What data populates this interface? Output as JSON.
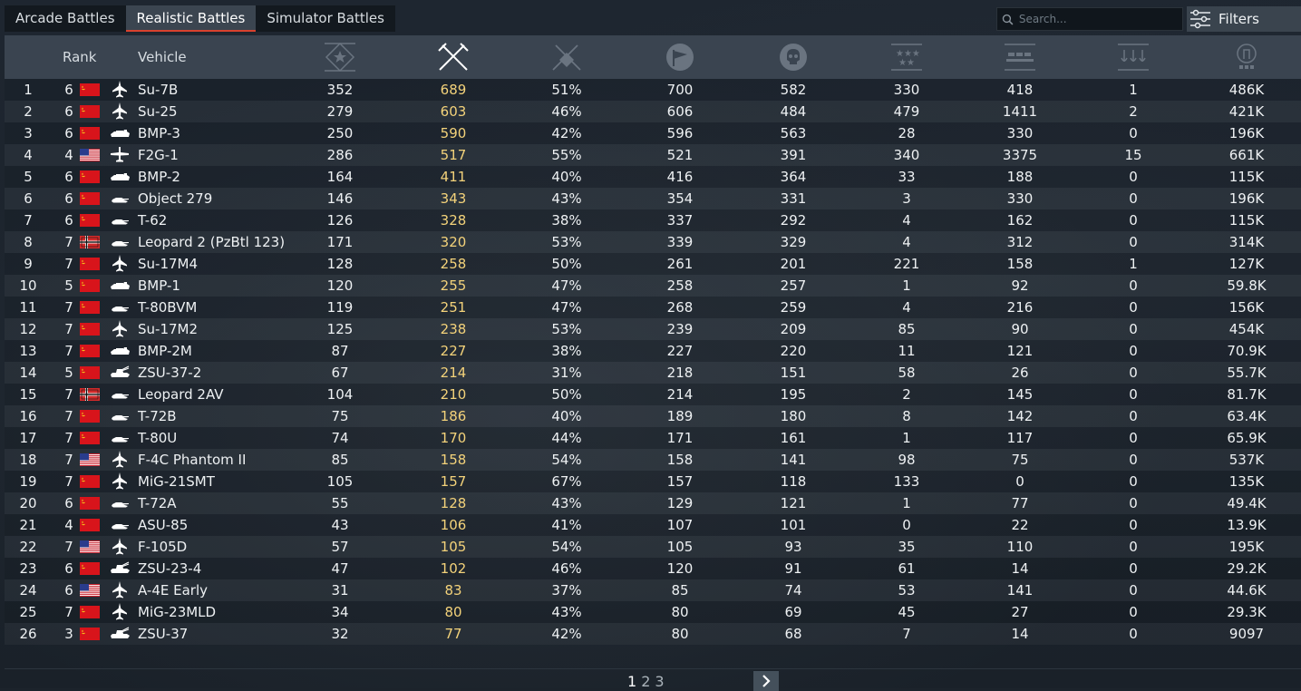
{
  "tabs": [
    {
      "label": "Arcade Battles",
      "active": false
    },
    {
      "label": "Realistic Battles",
      "active": true
    },
    {
      "label": "Simulator Battles",
      "active": false
    }
  ],
  "search": {
    "placeholder": "Search..."
  },
  "filters": {
    "label": "Filters"
  },
  "columns": {
    "rank": "Rank",
    "vehicle": "Vehicle",
    "icons": [
      "rating-icon",
      "battles-icon",
      "win-rate-icon",
      "victories-icon",
      "deaths-icon",
      "air-kills-icon",
      "ground-kills-icon",
      "naval-kills-icon",
      "rewards-icon"
    ]
  },
  "colors": {
    "accent": "#d9412e",
    "highlight": "#f3d27a",
    "header_bg": "#3a4450"
  },
  "rows": [
    {
      "pos": "1",
      "rank": "6",
      "nation": "ussr",
      "type": "jet",
      "vehicle": "Su-7B",
      "v1": "352",
      "battles": "689",
      "winrate": "51%",
      "v2": "700",
      "v3": "582",
      "v4": "330",
      "v5": "418",
      "v6": "1",
      "v7": "486K"
    },
    {
      "pos": "2",
      "rank": "6",
      "nation": "ussr",
      "type": "jet",
      "vehicle": "Su-25",
      "v1": "279",
      "battles": "603",
      "winrate": "46%",
      "v2": "606",
      "v3": "484",
      "v4": "479",
      "v5": "1411",
      "v6": "2",
      "v7": "421K"
    },
    {
      "pos": "3",
      "rank": "6",
      "nation": "ussr",
      "type": "ifv",
      "vehicle": "BMP-3",
      "v1": "250",
      "battles": "590",
      "winrate": "42%",
      "v2": "596",
      "v3": "563",
      "v4": "28",
      "v5": "330",
      "v6": "0",
      "v7": "196K"
    },
    {
      "pos": "4",
      "rank": "4",
      "nation": "usa",
      "type": "prop",
      "vehicle": "F2G-1",
      "v1": "286",
      "battles": "517",
      "winrate": "55%",
      "v2": "521",
      "v3": "391",
      "v4": "340",
      "v5": "3375",
      "v6": "15",
      "v7": "661K"
    },
    {
      "pos": "5",
      "rank": "6",
      "nation": "ussr",
      "type": "ifv",
      "vehicle": "BMP-2",
      "v1": "164",
      "battles": "411",
      "winrate": "40%",
      "v2": "416",
      "v3": "364",
      "v4": "33",
      "v5": "188",
      "v6": "0",
      "v7": "115K"
    },
    {
      "pos": "6",
      "rank": "6",
      "nation": "ussr",
      "type": "tank",
      "vehicle": "Object 279",
      "v1": "146",
      "battles": "343",
      "winrate": "43%",
      "v2": "354",
      "v3": "331",
      "v4": "3",
      "v5": "330",
      "v6": "0",
      "v7": "196K"
    },
    {
      "pos": "7",
      "rank": "6",
      "nation": "ussr",
      "type": "tank",
      "vehicle": "T-62",
      "v1": "126",
      "battles": "328",
      "winrate": "38%",
      "v2": "337",
      "v3": "292",
      "v4": "4",
      "v5": "162",
      "v6": "0",
      "v7": "115K"
    },
    {
      "pos": "8",
      "rank": "7",
      "nation": "germany",
      "type": "tank",
      "vehicle": "Leopard 2 (PzBtl 123)",
      "v1": "171",
      "battles": "320",
      "winrate": "53%",
      "v2": "339",
      "v3": "329",
      "v4": "4",
      "v5": "312",
      "v6": "0",
      "v7": "314K"
    },
    {
      "pos": "9",
      "rank": "7",
      "nation": "ussr",
      "type": "jet",
      "vehicle": "Su-17M4",
      "v1": "128",
      "battles": "258",
      "winrate": "50%",
      "v2": "261",
      "v3": "201",
      "v4": "221",
      "v5": "158",
      "v6": "1",
      "v7": "127K"
    },
    {
      "pos": "10",
      "rank": "5",
      "nation": "ussr",
      "type": "ifv",
      "vehicle": "BMP-1",
      "v1": "120",
      "battles": "255",
      "winrate": "47%",
      "v2": "258",
      "v3": "257",
      "v4": "1",
      "v5": "92",
      "v6": "0",
      "v7": "59.8K"
    },
    {
      "pos": "11",
      "rank": "7",
      "nation": "ussr",
      "type": "tank",
      "vehicle": "T-80BVM",
      "v1": "119",
      "battles": "251",
      "winrate": "47%",
      "v2": "268",
      "v3": "259",
      "v4": "4",
      "v5": "216",
      "v6": "0",
      "v7": "156K"
    },
    {
      "pos": "12",
      "rank": "7",
      "nation": "ussr",
      "type": "jet",
      "vehicle": "Su-17M2",
      "v1": "125",
      "battles": "238",
      "winrate": "53%",
      "v2": "239",
      "v3": "209",
      "v4": "85",
      "v5": "90",
      "v6": "0",
      "v7": "454K"
    },
    {
      "pos": "13",
      "rank": "7",
      "nation": "ussr",
      "type": "ifv",
      "vehicle": "BMP-2M",
      "v1": "87",
      "battles": "227",
      "winrate": "38%",
      "v2": "227",
      "v3": "220",
      "v4": "11",
      "v5": "121",
      "v6": "0",
      "v7": "70.9K"
    },
    {
      "pos": "14",
      "rank": "5",
      "nation": "ussr",
      "type": "spaa",
      "vehicle": "ZSU-37-2",
      "v1": "67",
      "battles": "214",
      "winrate": "31%",
      "v2": "218",
      "v3": "151",
      "v4": "58",
      "v5": "26",
      "v6": "0",
      "v7": "55.7K"
    },
    {
      "pos": "15",
      "rank": "7",
      "nation": "germany",
      "type": "tank",
      "vehicle": "Leopard 2AV",
      "v1": "104",
      "battles": "210",
      "winrate": "50%",
      "v2": "214",
      "v3": "195",
      "v4": "2",
      "v5": "145",
      "v6": "0",
      "v7": "81.7K"
    },
    {
      "pos": "16",
      "rank": "7",
      "nation": "ussr",
      "type": "tank",
      "vehicle": "T-72B",
      "v1": "75",
      "battles": "186",
      "winrate": "40%",
      "v2": "189",
      "v3": "180",
      "v4": "8",
      "v5": "142",
      "v6": "0",
      "v7": "63.4K"
    },
    {
      "pos": "17",
      "rank": "7",
      "nation": "ussr",
      "type": "tank",
      "vehicle": "T-80U",
      "v1": "74",
      "battles": "170",
      "winrate": "44%",
      "v2": "171",
      "v3": "161",
      "v4": "1",
      "v5": "117",
      "v6": "0",
      "v7": "65.9K"
    },
    {
      "pos": "18",
      "rank": "7",
      "nation": "usa",
      "type": "jet",
      "vehicle": "F-4C Phantom II",
      "v1": "85",
      "battles": "158",
      "winrate": "54%",
      "v2": "158",
      "v3": "141",
      "v4": "98",
      "v5": "75",
      "v6": "0",
      "v7": "537K"
    },
    {
      "pos": "19",
      "rank": "7",
      "nation": "ussr",
      "type": "jet",
      "vehicle": "MiG-21SMT",
      "v1": "105",
      "battles": "157",
      "winrate": "67%",
      "v2": "157",
      "v3": "118",
      "v4": "133",
      "v5": "0",
      "v6": "0",
      "v7": "135K"
    },
    {
      "pos": "20",
      "rank": "6",
      "nation": "ussr",
      "type": "tank",
      "vehicle": "T-72A",
      "v1": "55",
      "battles": "128",
      "winrate": "43%",
      "v2": "129",
      "v3": "121",
      "v4": "1",
      "v5": "77",
      "v6": "0",
      "v7": "49.4K"
    },
    {
      "pos": "21",
      "rank": "4",
      "nation": "ussr",
      "type": "tank",
      "vehicle": "ASU-85",
      "v1": "43",
      "battles": "106",
      "winrate": "41%",
      "v2": "107",
      "v3": "101",
      "v4": "0",
      "v5": "22",
      "v6": "0",
      "v7": "13.9K"
    },
    {
      "pos": "22",
      "rank": "7",
      "nation": "usa",
      "type": "jet",
      "vehicle": "F-105D",
      "v1": "57",
      "battles": "105",
      "winrate": "54%",
      "v2": "105",
      "v3": "93",
      "v4": "35",
      "v5": "110",
      "v6": "0",
      "v7": "195K"
    },
    {
      "pos": "23",
      "rank": "6",
      "nation": "ussr",
      "type": "spaa",
      "vehicle": "ZSU-23-4",
      "v1": "47",
      "battles": "102",
      "winrate": "46%",
      "v2": "120",
      "v3": "91",
      "v4": "61",
      "v5": "14",
      "v6": "0",
      "v7": "29.2K"
    },
    {
      "pos": "24",
      "rank": "6",
      "nation": "usa",
      "type": "jet",
      "vehicle": "A-4E Early",
      "v1": "31",
      "battles": "83",
      "winrate": "37%",
      "v2": "85",
      "v3": "74",
      "v4": "53",
      "v5": "141",
      "v6": "0",
      "v7": "44.6K"
    },
    {
      "pos": "25",
      "rank": "7",
      "nation": "ussr",
      "type": "jet",
      "vehicle": "MiG-23MLD",
      "v1": "34",
      "battles": "80",
      "winrate": "43%",
      "v2": "80",
      "v3": "69",
      "v4": "45",
      "v5": "27",
      "v6": "0",
      "v7": "29.3K"
    },
    {
      "pos": "26",
      "rank": "3",
      "nation": "ussr",
      "type": "spaa",
      "vehicle": "ZSU-37",
      "v1": "32",
      "battles": "77",
      "winrate": "42%",
      "v2": "80",
      "v3": "68",
      "v4": "7",
      "v5": "14",
      "v6": "0",
      "v7": "9097"
    }
  ],
  "pagination": {
    "pages": [
      "1",
      "2",
      "3"
    ],
    "current": "1"
  }
}
